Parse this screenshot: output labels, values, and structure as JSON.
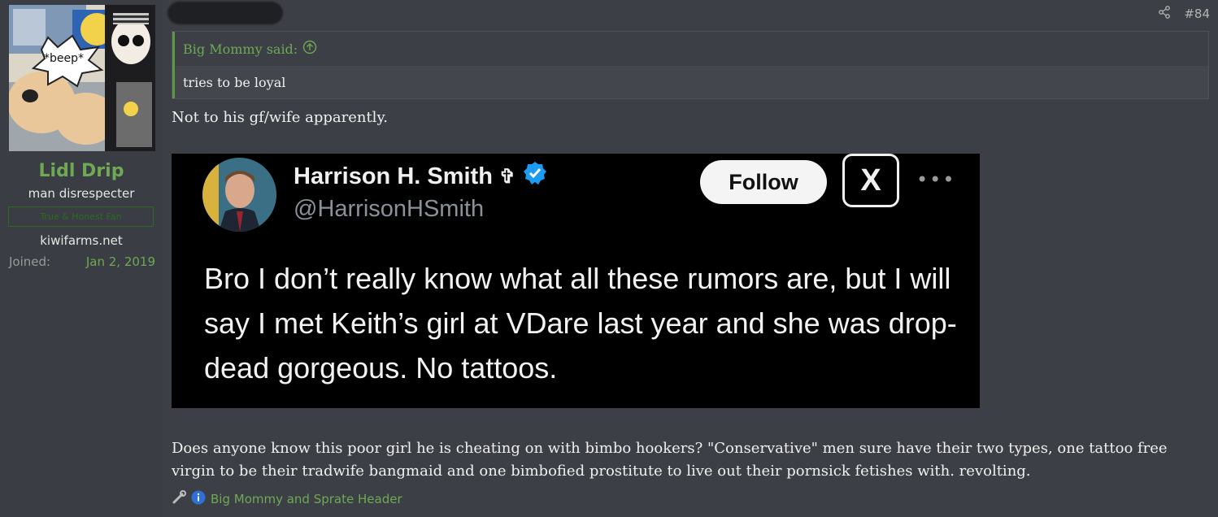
{
  "user": {
    "avatar_caption": "*beep*",
    "name": "Lidl Drip",
    "title": "man disrespecter",
    "banner": "True & Honest Fan",
    "site": "kiwifarms.net",
    "joined_label": "Joined:",
    "joined_value": "Jan 2, 2019"
  },
  "post": {
    "number": "#84",
    "quote": {
      "author": "Big Mommy said:",
      "text": "tries to be loyal"
    },
    "reply_text": "Not to his gf/wife apparently.",
    "tweet": {
      "name": "Harrison H. Smith",
      "handle": "@HarrisonHSmith",
      "follow_label": "Follow",
      "text": "Bro I don’t really know what all these rumors are, but I will say I met Keith’s girl at VDare last year and she was drop-dead gorgeous. No tattoos."
    },
    "closing_text": "Does anyone know this poor girl he is cheating on with bimbo hookers? \"Conservative\" men sure have their two types, one tattoo free virgin to be their tradwife bangmaid and one bimbofied prostitute to live out their pornsick fetishes with. revolting.",
    "reactions_text": "Big Mommy and Sprate Header"
  },
  "colors": {
    "accent_green": "#6fa954",
    "page_bg": "#3c3f45",
    "verified_blue": "#1d9bf0"
  }
}
